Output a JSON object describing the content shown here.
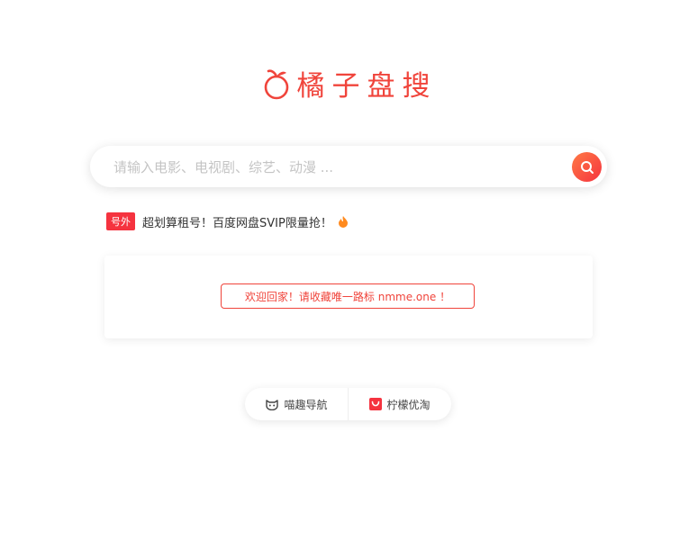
{
  "logo": {
    "text": "橘子盘搜",
    "icon": "orange-icon"
  },
  "search": {
    "placeholder": "请输入电影、电视剧、综艺、动漫 ...",
    "value": "",
    "icon": "search-icon"
  },
  "notice": {
    "badge": "号外",
    "text": "超划算租号！百度网盘SVIP限量抢！",
    "icon": "fire-icon"
  },
  "welcome": {
    "text": "欢迎回家！请收藏唯一路标 nmme.one ！"
  },
  "links": [
    {
      "label": "喵趣导航",
      "icon": "cat-face-icon"
    },
    {
      "label": "柠檬优淘",
      "icon": "shopping-bag-icon"
    }
  ],
  "colors": {
    "accent": "#f0443b",
    "button_gradient_start": "#ff7a45",
    "button_gradient_end": "#f5333f"
  }
}
